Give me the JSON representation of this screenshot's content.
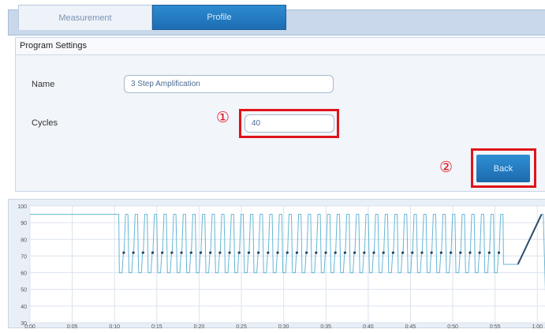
{
  "tabs": [
    {
      "label": "Measurement",
      "active": false
    },
    {
      "label": "Profile",
      "active": true
    }
  ],
  "program_settings": {
    "title": "Program Settings",
    "name_label": "Name",
    "name_value": "3 Step Amplification",
    "cycles_label": "Cycles",
    "cycles_value": "40",
    "back_label": "Back"
  },
  "annotations": {
    "marker_1": "①",
    "marker_2": "②",
    "highlight_color": "#e0141b"
  },
  "colors": {
    "accent": "#1f75bd",
    "trace": "#66b6d6",
    "dots": "#2a3f5a"
  },
  "chart_data": {
    "type": "line",
    "y_ticks": [
      "100",
      "90",
      "80",
      "70",
      "60",
      "50",
      "40",
      "30"
    ],
    "x_ticks": [
      "0:00",
      "0:05",
      "0:10",
      "0:15",
      "0:20",
      "0:25",
      "0:30",
      "0:35",
      "0:40",
      "0:45",
      "0:50",
      "0:55",
      "1:00"
    ],
    "ylim": [
      30,
      100
    ],
    "xlim_minutes": [
      0,
      61
    ],
    "grid": true,
    "initial_denature": {
      "temp": 95,
      "start_min": 0,
      "end_min": 10.5
    },
    "cycles": {
      "count": 40,
      "start_min": 10.5,
      "end_min": 56,
      "high_temp": 95,
      "low_temp": 60,
      "acquisition_temp": 72
    },
    "hold": {
      "temp": 65,
      "start_min": 56,
      "end_min": 57.7
    },
    "melt_ramp": {
      "from_temp": 65,
      "to_temp": 95,
      "start_min": 57.7,
      "end_min": 60.5
    },
    "cool_down": {
      "temp": 40,
      "at_min": 61
    }
  }
}
